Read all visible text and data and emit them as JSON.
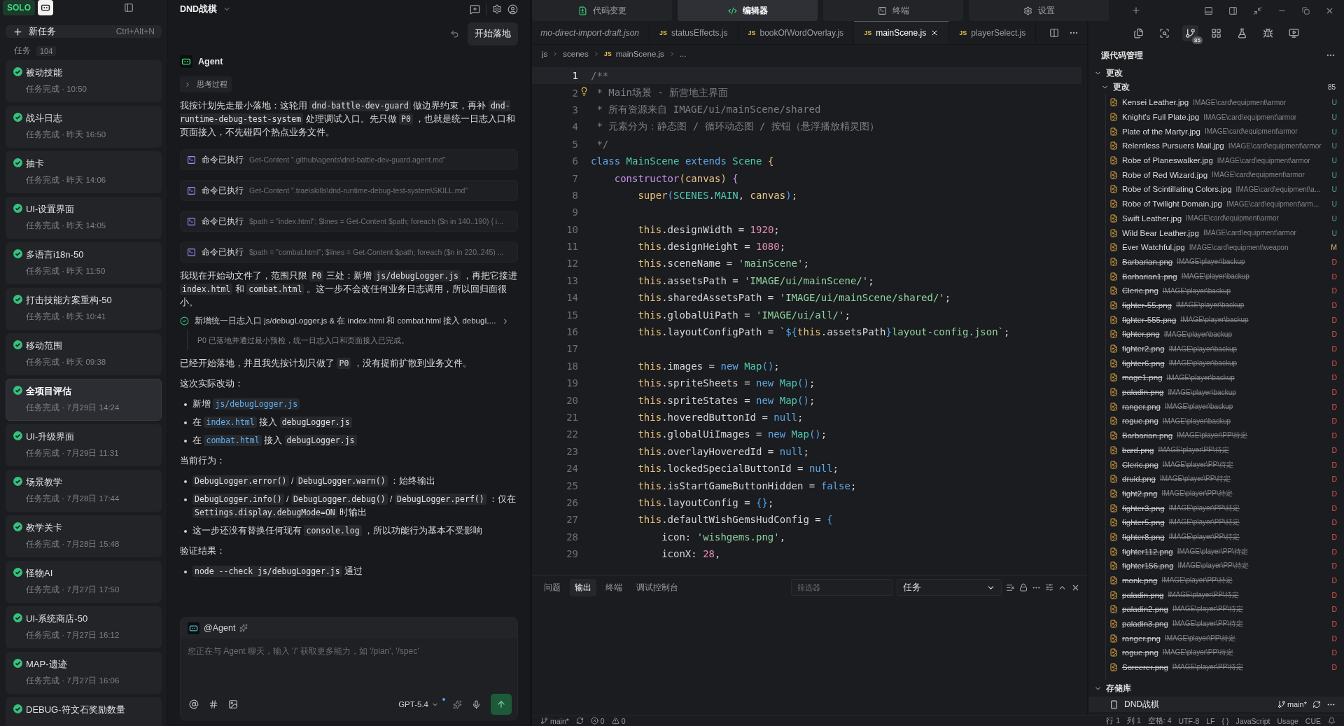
{
  "app": {
    "logo": "SOLO"
  },
  "sidebar": {
    "new_task": {
      "label": "新任务",
      "shortcut": "Ctrl+Alt+N"
    },
    "tasks_label": "任务",
    "tasks_count": "104",
    "tasks": [
      {
        "title": "被动技能",
        "subtitle": "任务完成 · 10:50",
        "selected": false
      },
      {
        "title": "战斗日志",
        "subtitle": "任务完成 · 昨天 16:50",
        "selected": false
      },
      {
        "title": "抽卡",
        "subtitle": "任务完成 · 昨天 14:06",
        "selected": false
      },
      {
        "title": "UI-设置界面",
        "subtitle": "任务完成 · 昨天 14:05",
        "selected": false
      },
      {
        "title": "多语言i18n-50",
        "subtitle": "任务完成 · 昨天 11:50",
        "selected": false
      },
      {
        "title": "打击技能方案重构-50",
        "subtitle": "任务完成 · 昨天 10:41",
        "selected": false
      },
      {
        "title": "移动范围",
        "subtitle": "任务完成 · 昨天 09:38",
        "selected": false
      },
      {
        "title": "全项目评估",
        "subtitle": "任务完成 · 7月29日 14:24",
        "selected": true
      },
      {
        "title": "UI-升级界面",
        "subtitle": "任务完成 · 7月29日 11:31",
        "selected": false
      },
      {
        "title": "场景教学",
        "subtitle": "任务完成 · 7月28日 17:44",
        "selected": false
      },
      {
        "title": "教学关卡",
        "subtitle": "任务完成 · 7月28日 15:48",
        "selected": false
      },
      {
        "title": "怪物AI",
        "subtitle": "任务完成 · 7月27日 17:50",
        "selected": false
      },
      {
        "title": "UI-系统商店-50",
        "subtitle": "任务完成 · 7月27日 16:12",
        "selected": false
      },
      {
        "title": "MAP-遗迹",
        "subtitle": "任务完成 · 7月27日 16:06",
        "selected": false
      },
      {
        "title": "DEBUG-符文石奖励数量",
        "selected": false
      }
    ]
  },
  "agent": {
    "project": "DND战棋",
    "start_button": "开始落地",
    "name": "Agent",
    "thinking": "思考过程",
    "blocks": [
      {
        "kind": "paragraph",
        "parts": [
          {
            "kind": "text",
            "t": "我按计划先走最小落地：这轮用 "
          },
          {
            "kind": "code",
            "t": "dnd-battle-dev-guard"
          },
          {
            "kind": "text",
            "t": " 做边界约束，再补 "
          },
          {
            "kind": "code",
            "t": "dnd-runtime-debug-test-system"
          },
          {
            "kind": "text",
            "t": " 处理调试入口。先只做 "
          },
          {
            "kind": "code",
            "t": "P0"
          },
          {
            "kind": "text",
            "t": " ，也就是统一日志入口和页面接入，不先碰四个热点业务文件。"
          }
        ]
      },
      {
        "kind": "command",
        "label": "命令已执行",
        "command": "Get-Content \".github\\agents\\dnd-battle-dev-guard.agent.md\""
      },
      {
        "kind": "command",
        "label": "命令已执行",
        "command": "Get-Content \".trae\\skills\\dnd-runtime-debug-test-system\\SKILL.md\""
      },
      {
        "kind": "command",
        "label": "命令已执行",
        "command": "$path = \"index.html\"; $lines = Get-Content $path; foreach ($n in 140..190) { i..."
      },
      {
        "kind": "command",
        "label": "命令已执行",
        "command": "$path = \"combat.html\"; $lines = Get-Content $path; foreach ($n in 220..245) ..."
      },
      {
        "kind": "paragraph",
        "parts": [
          {
            "kind": "text",
            "t": "我现在开始动文件了，范围只限 "
          },
          {
            "kind": "code",
            "t": "P0"
          },
          {
            "kind": "text",
            "t": " 三处：新增 "
          },
          {
            "kind": "code",
            "t": "js/debugLogger.js"
          },
          {
            "kind": "text",
            "t": " ，再把它接进 "
          },
          {
            "kind": "code",
            "t": "index.html"
          },
          {
            "kind": "text",
            "t": " 和 "
          },
          {
            "kind": "code",
            "t": "combat.html"
          },
          {
            "kind": "text",
            "t": " 。这一步不会改任何业务日志调用，所以回归面很小。"
          }
        ]
      },
      {
        "kind": "task",
        "done": true,
        "title": "新增统一日志入口 js/debugLogger.js & 在 index.html 和 combat.html 接入 debugL...",
        "note": "P0 已落地并通过最小预检，统一日志入口和页面接入已完成。"
      },
      {
        "kind": "paragraph",
        "parts": [
          {
            "kind": "text",
            "t": "已经开始落地，并且我先按计划只做了 "
          },
          {
            "kind": "code",
            "t": "P0"
          },
          {
            "kind": "text",
            "t": " ，没有提前扩散到业务文件。"
          }
        ]
      },
      {
        "kind": "paragraph",
        "parts": [
          {
            "kind": "text",
            "t": "这次实际改动："
          }
        ]
      },
      {
        "kind": "bullets",
        "items": [
          [
            {
              "kind": "text",
              "t": "新增 "
            },
            {
              "kind": "path",
              "t": "js/debugLogger.js"
            }
          ],
          [
            {
              "kind": "text",
              "t": "在 "
            },
            {
              "kind": "path",
              "t": "index.html"
            },
            {
              "kind": "text",
              "t": " 接入 "
            },
            {
              "kind": "code",
              "t": "debugLogger.js"
            }
          ],
          [
            {
              "kind": "text",
              "t": "在 "
            },
            {
              "kind": "path",
              "t": "combat.html"
            },
            {
              "kind": "text",
              "t": " 接入 "
            },
            {
              "kind": "code",
              "t": "debugLogger.js"
            }
          ]
        ]
      },
      {
        "kind": "paragraph",
        "parts": [
          {
            "kind": "text",
            "t": "当前行为："
          }
        ]
      },
      {
        "kind": "bullets",
        "items": [
          [
            {
              "kind": "code",
              "t": "DebugLogger.error()"
            },
            {
              "kind": "text",
              "t": " / "
            },
            {
              "kind": "code",
              "t": "DebugLogger.warn()"
            },
            {
              "kind": "text",
              "t": " ：始终输出"
            }
          ],
          [
            {
              "kind": "code",
              "t": "DebugLogger.info()"
            },
            {
              "kind": "text",
              "t": " / "
            },
            {
              "kind": "code",
              "t": "DebugLogger.debug()"
            },
            {
              "kind": "text",
              "t": " / "
            },
            {
              "kind": "code",
              "t": "DebugLogger.perf()"
            },
            {
              "kind": "text",
              "t": " ：仅在 "
            },
            {
              "kind": "code",
              "t": "Settings.display.debugMode=ON"
            },
            {
              "kind": "text",
              "t": " 时输出"
            }
          ],
          [
            {
              "kind": "text",
              "t": "这一步还没有替换任何现有 "
            },
            {
              "kind": "code",
              "t": "console.log"
            },
            {
              "kind": "text",
              "t": " ，所以功能行为基本不受影响"
            }
          ]
        ]
      },
      {
        "kind": "paragraph",
        "parts": [
          {
            "kind": "text",
            "t": "验证结果："
          }
        ]
      },
      {
        "kind": "bullets",
        "items": [
          [
            {
              "kind": "code",
              "t": "node --check js/debugLogger.js"
            },
            {
              "kind": "text",
              "t": " 通过"
            }
          ]
        ]
      }
    ],
    "input": {
      "mention": "@Agent",
      "placeholder": "您正在与 Agent 聊天，输入 '/' 获取更多能力，如 '/plan', '/spec'",
      "model": "GPT-5.4"
    }
  },
  "top_tabs": [
    {
      "label": "代码变更",
      "kind": "diff",
      "selected": false
    },
    {
      "label": "编辑器",
      "kind": "code",
      "selected": true
    },
    {
      "label": "终端",
      "kind": "terminal",
      "selected": false
    },
    {
      "label": "设置",
      "kind": "settings",
      "selected": false
    }
  ],
  "editor": {
    "tabs": [
      {
        "name": "mo-direct-import-draft.json",
        "preview": true,
        "selected": false
      },
      {
        "icon": "JS",
        "name": "statusEffects.js",
        "preview": false,
        "selected": false
      },
      {
        "icon": "JS",
        "name": "bookOfWordOverlay.js",
        "preview": false,
        "selected": false
      },
      {
        "icon": "JS",
        "name": "mainScene.js",
        "preview": false,
        "selected": true
      },
      {
        "icon": "JS",
        "name": "playerSelect.js",
        "preview": false,
        "selected": false
      }
    ],
    "breadcrumb": [
      {
        "t": "js"
      },
      {
        "t": "scenes"
      },
      {
        "icon": "JS",
        "t": "mainScene.js"
      },
      {
        "t": "..."
      }
    ],
    "lines": [
      {
        "n": "1",
        "current": true,
        "tokens": [
          {
            "kind": "cm",
            "t": "/**"
          }
        ]
      },
      {
        "n": "2",
        "current": false,
        "hint": true,
        "tokens": [
          {
            "kind": "cm",
            "t": " * Main场景 - 新营地主界面"
          }
        ]
      },
      {
        "n": "3",
        "current": false,
        "tokens": [
          {
            "kind": "cm",
            "t": " * 所有资源来自 IMAGE/ui/mainScene/shared"
          }
        ]
      },
      {
        "n": "4",
        "current": false,
        "tokens": [
          {
            "kind": "cm",
            "t": " * 元素分为：静态图 / 循环动态图 / 按钮（悬浮播放精灵图）"
          }
        ]
      },
      {
        "n": "5",
        "current": false,
        "tokens": [
          {
            "kind": "cm",
            "t": " */"
          }
        ]
      },
      {
        "n": "6",
        "current": false,
        "tokens": [
          {
            "kind": "kw",
            "t": "class "
          },
          {
            "kind": "cls",
            "t": "MainScene "
          },
          {
            "kind": "kw",
            "t": "extends "
          },
          {
            "kind": "cls",
            "t": "Scene "
          },
          {
            "kind": "br",
            "t": "{"
          }
        ]
      },
      {
        "n": "7",
        "current": false,
        "tokens": [
          {
            "kind": "fn",
            "t": "    constructor"
          },
          {
            "kind": "br",
            "t": "("
          },
          {
            "kind": "pa",
            "t": "canvas"
          },
          {
            "kind": "br",
            "t": ")"
          },
          {
            "kind": "fn",
            "t": " {"
          }
        ]
      },
      {
        "n": "8",
        "current": false,
        "tokens": [
          {
            "kind": "th",
            "t": "        super"
          },
          {
            "kind": "ip",
            "t": "("
          },
          {
            "kind": "cls",
            "t": "SCENES"
          },
          {
            "kind": "p",
            "t": "."
          },
          {
            "kind": "cls",
            "t": "MAIN"
          },
          {
            "kind": "p",
            "t": ", "
          },
          {
            "kind": "pa",
            "t": "canvas"
          },
          {
            "kind": "ip",
            "t": ")"
          },
          {
            "kind": "p",
            "t": ";"
          }
        ]
      },
      {
        "n": "9",
        "current": false
      },
      {
        "n": "10",
        "current": false,
        "tokens": [
          {
            "kind": "th",
            "t": "        this"
          },
          {
            "kind": "p",
            "t": ".designWidth = "
          },
          {
            "kind": "num",
            "t": "1920"
          },
          {
            "kind": "p",
            "t": ";"
          }
        ]
      },
      {
        "n": "11",
        "current": false,
        "tokens": [
          {
            "kind": "th",
            "t": "        this"
          },
          {
            "kind": "p",
            "t": ".designHeight = "
          },
          {
            "kind": "num",
            "t": "1080"
          },
          {
            "kind": "p",
            "t": ";"
          }
        ]
      },
      {
        "n": "12",
        "current": false,
        "tokens": [
          {
            "kind": "th",
            "t": "        this"
          },
          {
            "kind": "p",
            "t": ".sceneName = "
          },
          {
            "kind": "str",
            "t": "'mainScene'"
          },
          {
            "kind": "p",
            "t": ";"
          }
        ]
      },
      {
        "n": "13",
        "current": false,
        "tokens": [
          {
            "kind": "th",
            "t": "        this"
          },
          {
            "kind": "p",
            "t": ".assetsPath = "
          },
          {
            "kind": "str",
            "t": "'IMAGE/ui/mainScene/'"
          },
          {
            "kind": "p",
            "t": ";"
          }
        ]
      },
      {
        "n": "14",
        "current": false,
        "tokens": [
          {
            "kind": "th",
            "t": "        this"
          },
          {
            "kind": "p",
            "t": ".sharedAssetsPath = "
          },
          {
            "kind": "str",
            "t": "'IMAGE/ui/mainScene/shared/'"
          },
          {
            "kind": "p",
            "t": ";"
          }
        ]
      },
      {
        "n": "15",
        "current": false,
        "tokens": [
          {
            "kind": "th",
            "t": "        this"
          },
          {
            "kind": "p",
            "t": ".globalUiPath = "
          },
          {
            "kind": "str",
            "t": "'IMAGE/ui/all/'"
          },
          {
            "kind": "p",
            "t": ";"
          }
        ]
      },
      {
        "n": "16",
        "current": false,
        "tokens": [
          {
            "kind": "th",
            "t": "        this"
          },
          {
            "kind": "p",
            "t": ".layoutConfigPath = "
          },
          {
            "kind": "str",
            "t": "`"
          },
          {
            "kind": "ip",
            "t": "${"
          },
          {
            "kind": "th",
            "t": "this"
          },
          {
            "kind": "p",
            "t": ".assetsPath"
          },
          {
            "kind": "ip",
            "t": "}"
          },
          {
            "kind": "str",
            "t": "layout-config.json`"
          },
          {
            "kind": "p",
            "t": ";"
          }
        ]
      },
      {
        "n": "17",
        "current": false
      },
      {
        "n": "18",
        "current": false,
        "tokens": [
          {
            "kind": "th",
            "t": "        this"
          },
          {
            "kind": "p",
            "t": ".images = "
          },
          {
            "kind": "kw",
            "t": "new "
          },
          {
            "kind": "cls",
            "t": "Map"
          },
          {
            "kind": "ip",
            "t": "()"
          },
          {
            "kind": "p",
            "t": ";"
          }
        ]
      },
      {
        "n": "19",
        "current": false,
        "tokens": [
          {
            "kind": "th",
            "t": "        this"
          },
          {
            "kind": "p",
            "t": ".spriteSheets = "
          },
          {
            "kind": "kw",
            "t": "new "
          },
          {
            "kind": "cls",
            "t": "Map"
          },
          {
            "kind": "ip",
            "t": "()"
          },
          {
            "kind": "p",
            "t": ";"
          }
        ]
      },
      {
        "n": "20",
        "current": false,
        "tokens": [
          {
            "kind": "th",
            "t": "        this"
          },
          {
            "kind": "p",
            "t": ".spriteStates = "
          },
          {
            "kind": "kw",
            "t": "new "
          },
          {
            "kind": "cls",
            "t": "Map"
          },
          {
            "kind": "ip",
            "t": "()"
          },
          {
            "kind": "p",
            "t": ";"
          }
        ]
      },
      {
        "n": "21",
        "current": false,
        "tokens": [
          {
            "kind": "th",
            "t": "        this"
          },
          {
            "kind": "p",
            "t": ".hoveredButtonId = "
          },
          {
            "kind": "kw",
            "t": "null"
          },
          {
            "kind": "p",
            "t": ";"
          }
        ]
      },
      {
        "n": "22",
        "current": false,
        "tokens": [
          {
            "kind": "th",
            "t": "        this"
          },
          {
            "kind": "p",
            "t": ".globalUiImages = "
          },
          {
            "kind": "kw",
            "t": "new "
          },
          {
            "kind": "cls",
            "t": "Map"
          },
          {
            "kind": "ip",
            "t": "()"
          },
          {
            "kind": "p",
            "t": ";"
          }
        ]
      },
      {
        "n": "23",
        "current": false,
        "tokens": [
          {
            "kind": "th",
            "t": "        this"
          },
          {
            "kind": "p",
            "t": ".overlayHoveredId = "
          },
          {
            "kind": "kw",
            "t": "null"
          },
          {
            "kind": "p",
            "t": ";"
          }
        ]
      },
      {
        "n": "24",
        "current": false,
        "tokens": [
          {
            "kind": "th",
            "t": "        this"
          },
          {
            "kind": "p",
            "t": ".lockedSpecialButtonId = "
          },
          {
            "kind": "kw",
            "t": "null"
          },
          {
            "kind": "p",
            "t": ";"
          }
        ]
      },
      {
        "n": "25",
        "current": false,
        "tokens": [
          {
            "kind": "th",
            "t": "        this"
          },
          {
            "kind": "p",
            "t": ".isStartGameButtonHidden = "
          },
          {
            "kind": "kw",
            "t": "false"
          },
          {
            "kind": "p",
            "t": ";"
          }
        ]
      },
      {
        "n": "26",
        "current": false,
        "tokens": [
          {
            "kind": "th",
            "t": "        this"
          },
          {
            "kind": "p",
            "t": ".layoutConfig = "
          },
          {
            "kind": "ip",
            "t": "{}"
          },
          {
            "kind": "p",
            "t": ";"
          }
        ]
      },
      {
        "n": "27",
        "current": false,
        "tokens": [
          {
            "kind": "th",
            "t": "        this"
          },
          {
            "kind": "p",
            "t": ".defaultWishGemsHudConfig = "
          },
          {
            "kind": "ip",
            "t": "{"
          }
        ]
      },
      {
        "n": "28",
        "current": false,
        "tokens": [
          {
            "kind": "p",
            "t": "            icon: "
          },
          {
            "kind": "str",
            "t": "'wishgems.png'"
          },
          {
            "kind": "p",
            "t": ","
          }
        ]
      },
      {
        "n": "29",
        "current": false,
        "tokens": [
          {
            "kind": "p",
            "t": "            iconX: "
          },
          {
            "kind": "num",
            "t": "28"
          },
          {
            "kind": "p",
            "t": ","
          }
        ]
      }
    ]
  },
  "panel": {
    "tabs": [
      {
        "label": "问题",
        "selected": false
      },
      {
        "label": "输出",
        "selected": true
      },
      {
        "label": "终端",
        "selected": false
      },
      {
        "label": "调试控制台",
        "selected": false
      }
    ],
    "filter_placeholder": "筛选器",
    "channel": "任务"
  },
  "scm": {
    "badge": "85",
    "title": "源代码管理",
    "section": "更改",
    "group": "更改",
    "count": "85",
    "files": [
      {
        "name": "Kensei Leather.jpg",
        "path": "IMAGE\\card\\equipment\\armor",
        "status": "U"
      },
      {
        "name": "Knight's Full Plate.jpg",
        "path": "IMAGE\\card\\equipment\\armor",
        "status": "U"
      },
      {
        "name": "Plate of the Martyr.jpg",
        "path": "IMAGE\\card\\equipment\\armor",
        "status": "U"
      },
      {
        "name": "Relentless Pursuers Mail.jpg",
        "path": "IMAGE\\card\\equipment\\armor",
        "status": "U"
      },
      {
        "name": "Robe of Planeswalker.jpg",
        "path": "IMAGE\\card\\equipment\\armor",
        "status": "U"
      },
      {
        "name": "Robe of Red Wizard.jpg",
        "path": "IMAGE\\card\\equipment\\armor",
        "status": "U"
      },
      {
        "name": "Robe of Scintillating Colors.jpg",
        "path": "IMAGE\\card\\equipment\\a...",
        "status": "U"
      },
      {
        "name": "Robe of Twilight Domain.jpg",
        "path": "IMAGE\\card\\equipment\\arm...",
        "status": "U"
      },
      {
        "name": "Swift Leather.jpg",
        "path": "IMAGE\\card\\equipment\\armor",
        "status": "U"
      },
      {
        "name": "Wild Bear Leather.jpg",
        "path": "IMAGE\\card\\equipment\\armor",
        "status": "U"
      },
      {
        "name": "Ever Watchful.jpg",
        "path": "IMAGE\\card\\equipment\\weapon",
        "status": "M"
      },
      {
        "name": "Barbarian.png",
        "path": "IMAGE\\player\\backup",
        "status": "D"
      },
      {
        "name": "Barbarian1.png",
        "path": "IMAGE\\player\\backup",
        "status": "D"
      },
      {
        "name": "Cleric.png",
        "path": "IMAGE\\player\\backup",
        "status": "D"
      },
      {
        "name": "fighter-55.png",
        "path": "IMAGE\\player\\backup",
        "status": "D"
      },
      {
        "name": "fighter-555.png",
        "path": "IMAGE\\player\\backup",
        "status": "D"
      },
      {
        "name": "fighter.png",
        "path": "IMAGE\\player\\backup",
        "status": "D"
      },
      {
        "name": "fighter2.png",
        "path": "IMAGE\\player\\backup",
        "status": "D"
      },
      {
        "name": "fighter6.png",
        "path": "IMAGE\\player\\backup",
        "status": "D"
      },
      {
        "name": "mage1.png",
        "path": "IMAGE\\player\\backup",
        "status": "D"
      },
      {
        "name": "paladin.png",
        "path": "IMAGE\\player\\backup",
        "status": "D"
      },
      {
        "name": "ranger.png",
        "path": "IMAGE\\player\\backup",
        "status": "D"
      },
      {
        "name": "rogue.png",
        "path": "IMAGE\\player\\backup",
        "status": "D"
      },
      {
        "name": "Barbarian.png",
        "path": "IMAGE\\player\\PP\\待定",
        "status": "D"
      },
      {
        "name": "bard.png",
        "path": "IMAGE\\player\\PP\\待定",
        "status": "D"
      },
      {
        "name": "Cleric.png",
        "path": "IMAGE\\player\\PP\\待定",
        "status": "D"
      },
      {
        "name": "druid.png",
        "path": "IMAGE\\player\\PP\\待定",
        "status": "D"
      },
      {
        "name": "fight2.png",
        "path": "IMAGE\\player\\PP\\待定",
        "status": "D"
      },
      {
        "name": "fighter3.png",
        "path": "IMAGE\\player\\PP\\待定",
        "status": "D"
      },
      {
        "name": "fighter5.png",
        "path": "IMAGE\\player\\PP\\待定",
        "status": "D"
      },
      {
        "name": "fighter8.png",
        "path": "IMAGE\\player\\PP\\待定",
        "status": "D"
      },
      {
        "name": "fighter112.png",
        "path": "IMAGE\\player\\PP\\待定",
        "status": "D"
      },
      {
        "name": "fighter156.png",
        "path": "IMAGE\\player\\PP\\待定",
        "status": "D"
      },
      {
        "name": "monk.png",
        "path": "IMAGE\\player\\PP\\待定",
        "status": "D"
      },
      {
        "name": "paladin.png",
        "path": "IMAGE\\player\\PP\\待定",
        "status": "D"
      },
      {
        "name": "paladin2.png",
        "path": "IMAGE\\player\\PP\\待定",
        "status": "D"
      },
      {
        "name": "paladin3.png",
        "path": "IMAGE\\player\\PP\\待定",
        "status": "D"
      },
      {
        "name": "ranger.png",
        "path": "IMAGE\\player\\PP\\待定",
        "status": "D"
      },
      {
        "name": "rogue.png",
        "path": "IMAGE\\player\\PP\\待定",
        "status": "D"
      },
      {
        "name": "Sorcerer.png",
        "path": "IMAGE\\player\\PP\\待定",
        "status": "D"
      }
    ],
    "repos_title": "存储库",
    "repo": {
      "name": "DND战棋",
      "branch": "main*"
    }
  },
  "status_bar": {
    "branch": "main*",
    "errors": "0",
    "warnings": "0",
    "right": [
      "行 1",
      "列 1",
      "空格: 4",
      "UTF-8",
      "LF",
      "{ }",
      "JavaScript",
      "Usage",
      "CUE"
    ]
  }
}
